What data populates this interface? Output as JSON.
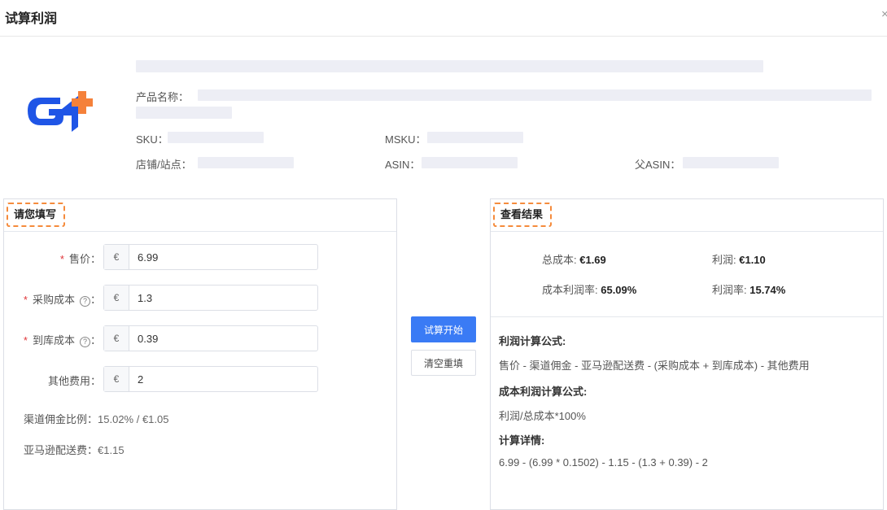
{
  "dialog": {
    "title": "试算利润",
    "close_glyph": "×"
  },
  "product_info": {
    "name_label": "产品名称：",
    "sku_label": "SKU：",
    "msku_label": "MSKU：",
    "store_label": "店铺/站点：",
    "asin_label": "ASIN：",
    "parent_asin_label": "父ASIN："
  },
  "input_panel": {
    "title": "请您填写",
    "fields": [
      {
        "label": "售价",
        "required": true,
        "help": false,
        "prefix": "€",
        "value": "6.99"
      },
      {
        "label": "采购成本",
        "required": true,
        "help": true,
        "prefix": "€",
        "value": "1.3"
      },
      {
        "label": "到库成本",
        "required": true,
        "help": true,
        "prefix": "€",
        "value": "0.39"
      },
      {
        "label": "其他费用",
        "required": false,
        "help": false,
        "prefix": "€",
        "value": "2"
      }
    ],
    "commission_label": "渠道佣金比例：",
    "commission_value": "15.02% / €1.05",
    "fba_label": "亚马逊配送费：",
    "fba_value": "€1.15",
    "colon": "：",
    "help_glyph": "?",
    "required_mark": "*"
  },
  "actions": {
    "start_label": "试算开始",
    "clear_label": "清空重填"
  },
  "result_panel": {
    "title": "查看结果",
    "total_cost_label": "总成本: ",
    "total_cost_value": "€1.69",
    "profit_label": "利润: ",
    "profit_value": "€1.10",
    "cost_margin_label": "成本利润率: ",
    "cost_margin_value": "65.09%",
    "profit_margin_label": "利润率: ",
    "profit_margin_value": "15.74%",
    "profit_formula_title": "利润计算公式:",
    "profit_formula": "售价 - 渠道佣金 - 亚马逊配送费 - (采购成本 + 到库成本) - 其他费用",
    "cost_formula_title": "成本利润计算公式:",
    "cost_formula": "利润/总成本*100%",
    "detail_title": "计算详情:",
    "detail": "6.99 - (6.99 * 0.1502) - 1.15 - (1.3 + 0.39) - 2"
  },
  "colors": {
    "accent": "#3a7bf5",
    "highlight_border": "#f58b3c",
    "required": "#e0363a",
    "logo_blue": "#1f55e6",
    "logo_orange": "#f5813a"
  }
}
